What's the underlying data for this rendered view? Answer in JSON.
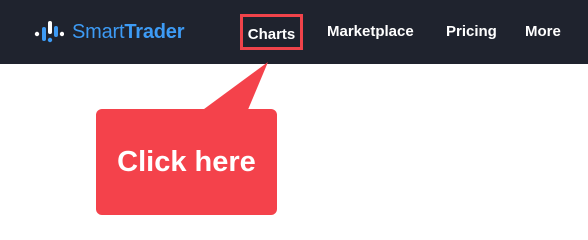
{
  "brand": {
    "name_light": "Smart",
    "name_bold": "Trader",
    "logo_icon": "bar-chart-logo-icon",
    "color": "#3d9bf5"
  },
  "nav": {
    "items": [
      {
        "label": "Charts",
        "highlighted": true
      },
      {
        "label": "Marketplace",
        "highlighted": false
      },
      {
        "label": "Pricing",
        "highlighted": false
      },
      {
        "label": "More",
        "highlighted": false
      }
    ]
  },
  "callout": {
    "text": "Click here",
    "color": "#f4424b"
  },
  "colors": {
    "navbar_bg": "#1f232e",
    "highlight_border": "#f0434a"
  }
}
